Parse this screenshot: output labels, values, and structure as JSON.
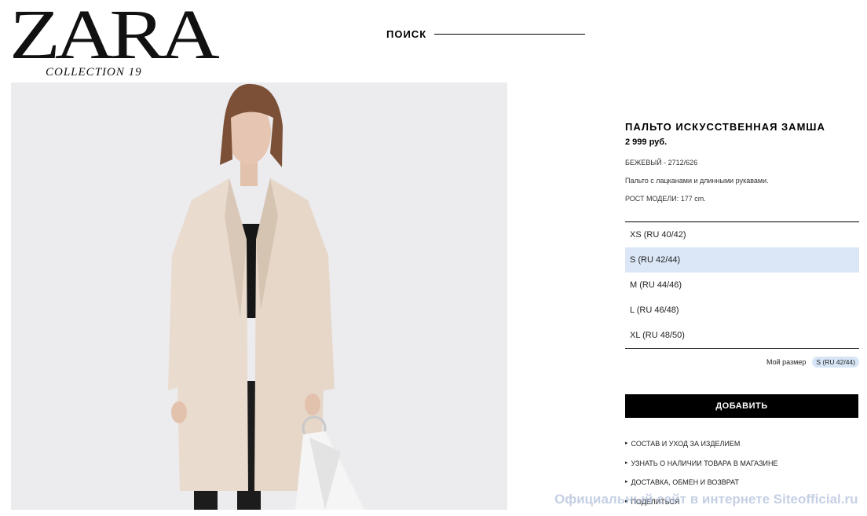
{
  "brand": {
    "wordmark": "ZARA",
    "collection": "COLLECTION 19"
  },
  "header": {
    "search_label": "ПОИСК"
  },
  "product": {
    "title": "ПАЛЬТО ИСКУССТВЕННАЯ ЗАМША",
    "price": "2 999 руб.",
    "color_code": "БЕЖЕВЫЙ - 2712/626",
    "description": "Пальто с лацканами и длинными рукавами.",
    "model_height": "РОСТ МОДЕЛИ: 177 cm."
  },
  "sizes": [
    {
      "label": "XS (RU 40/42)",
      "selected": false
    },
    {
      "label": "S (RU 42/44)",
      "selected": true
    },
    {
      "label": "M (RU 44/46)",
      "selected": false
    },
    {
      "label": "L (RU 46/48)",
      "selected": false
    },
    {
      "label": "XL (RU 48/50)",
      "selected": false
    }
  ],
  "my_size": {
    "label": "Мой размер",
    "value": "S (RU 42/44)"
  },
  "add_button": "ДОБАВИТЬ",
  "links": [
    "СОСТАВ И УХОД ЗА ИЗДЕЛИЕМ",
    "УЗНАТЬ О НАЛИЧИИ ТОВАРА В МАГАЗИНЕ",
    "ДОСТАВКА, ОБМЕН И ВОЗВРАТ",
    "ПОДЕЛИТЬСЯ"
  ],
  "watermark": "Официальный сайт в интернете Siteofficial.ru",
  "colors": {
    "selected_size_bg": "#dbe7f6",
    "button_bg": "#000000",
    "coat": "#e8d9cc",
    "photo_bg": "#ecebee"
  }
}
